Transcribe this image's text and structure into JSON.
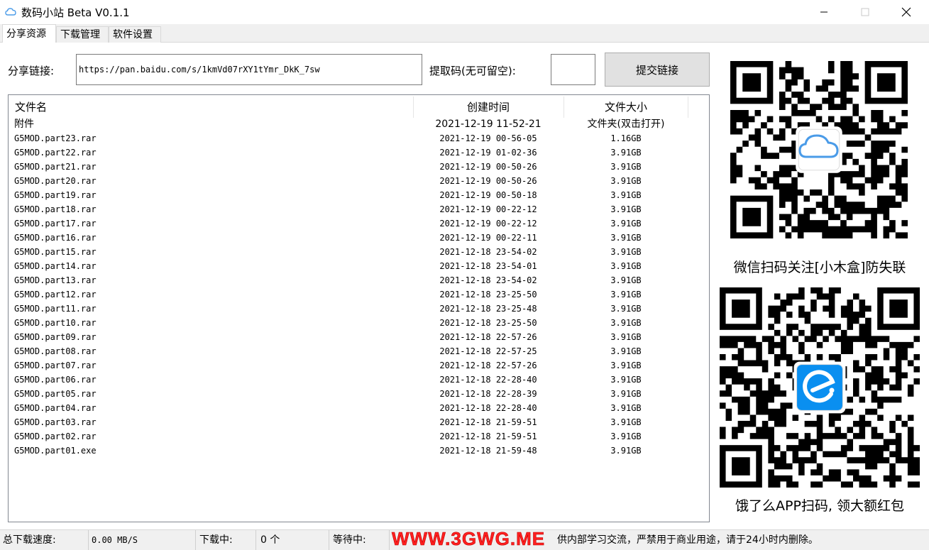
{
  "window": {
    "title": "数码小站 Beta V0.1.1",
    "icon": "cloud-icon",
    "controls": [
      "minimize-icon",
      "maximize-icon",
      "close-icon"
    ]
  },
  "tabs": [
    {
      "label": "分享资源",
      "active": true
    },
    {
      "label": "下载管理",
      "active": false
    },
    {
      "label": "软件设置",
      "active": false
    }
  ],
  "form": {
    "share_label": "分享链接:",
    "share_value": "https://pan.baidu.com/s/1kmVd07rXY1tYmr_DkK_7sw",
    "code_label": "提取码(无可留空):",
    "code_value": "",
    "submit_label": "提交链接"
  },
  "file_list": {
    "columns": [
      "文件名",
      "创建时间",
      "文件大小"
    ],
    "rows": [
      [
        "附件",
        "2021-12-19 11-52-21",
        "文件夹(双击打开)"
      ],
      [
        "G5MOD.part23.rar",
        "2021-12-19 00-56-05",
        "1.16GB"
      ],
      [
        "G5MOD.part22.rar",
        "2021-12-19 01-02-36",
        "3.91GB"
      ],
      [
        "G5MOD.part21.rar",
        "2021-12-19 00-50-26",
        "3.91GB"
      ],
      [
        "G5MOD.part20.rar",
        "2021-12-19 00-50-26",
        "3.91GB"
      ],
      [
        "G5MOD.part19.rar",
        "2021-12-19 00-50-18",
        "3.91GB"
      ],
      [
        "G5MOD.part18.rar",
        "2021-12-19 00-22-12",
        "3.91GB"
      ],
      [
        "G5MOD.part17.rar",
        "2021-12-19 00-22-12",
        "3.91GB"
      ],
      [
        "G5MOD.part16.rar",
        "2021-12-19 00-22-11",
        "3.91GB"
      ],
      [
        "G5MOD.part15.rar",
        "2021-12-18 23-54-02",
        "3.91GB"
      ],
      [
        "G5MOD.part14.rar",
        "2021-12-18 23-54-01",
        "3.91GB"
      ],
      [
        "G5MOD.part13.rar",
        "2021-12-18 23-54-02",
        "3.91GB"
      ],
      [
        "G5MOD.part12.rar",
        "2021-12-18 23-25-50",
        "3.91GB"
      ],
      [
        "G5MOD.part11.rar",
        "2021-12-18 23-25-48",
        "3.91GB"
      ],
      [
        "G5MOD.part10.rar",
        "2021-12-18 23-25-50",
        "3.91GB"
      ],
      [
        "G5MOD.part09.rar",
        "2021-12-18 22-57-26",
        "3.91GB"
      ],
      [
        "G5MOD.part08.rar",
        "2021-12-18 22-57-25",
        "3.91GB"
      ],
      [
        "G5MOD.part07.rar",
        "2021-12-18 22-57-26",
        "3.91GB"
      ],
      [
        "G5MOD.part06.rar",
        "2021-12-18 22-28-40",
        "3.91GB"
      ],
      [
        "G5MOD.part05.rar",
        "2021-12-18 22-28-39",
        "3.91GB"
      ],
      [
        "G5MOD.part04.rar",
        "2021-12-18 22-28-40",
        "3.91GB"
      ],
      [
        "G5MOD.part03.rar",
        "2021-12-18 21-59-51",
        "3.91GB"
      ],
      [
        "G5MOD.part02.rar",
        "2021-12-18 21-59-51",
        "3.91GB"
      ],
      [
        "G5MOD.part01.exe",
        "2021-12-18 21-59-48",
        "3.91GB"
      ]
    ]
  },
  "qr": {
    "wechat_caption": "微信扫码关注[小木盒]防失联",
    "eleme_caption": "饿了么APP扫码, 领大额红包",
    "wechat_center_icon": "cloud-icon",
    "eleme_center_icon": "eleme-logo-icon"
  },
  "status": {
    "speed_label": "总下载速度:",
    "speed_value": "0.00 MB/S",
    "downloading_label": "下载中:",
    "downloading_value": "0 个",
    "waiting_label": "等待中:",
    "notice": "供内部学习交流，严禁用于商业用途，请于24小时内删除。"
  },
  "watermark": "WWW.3GWG.ME",
  "colors": {
    "watermark": "#ff2020",
    "eleme_blue": "#0a8ff0",
    "cloud_blue": "#4a9be8"
  }
}
